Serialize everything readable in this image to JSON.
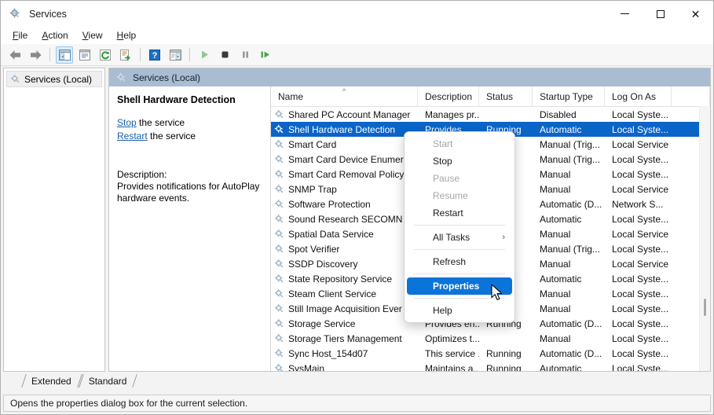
{
  "window": {
    "title": "Services",
    "icon": "services-gear-icon",
    "controls": {
      "minimize": "Minimize",
      "maximize": "Maximize",
      "close": "Close"
    }
  },
  "menubar": {
    "items": [
      {
        "label": "File",
        "accel": "F"
      },
      {
        "label": "Action",
        "accel": "A"
      },
      {
        "label": "View",
        "accel": "V"
      },
      {
        "label": "Help",
        "accel": "H"
      }
    ]
  },
  "toolbar": {
    "buttons": [
      {
        "name": "back-icon",
        "enabled": false
      },
      {
        "name": "forward-icon",
        "enabled": false
      },
      {
        "name": "separator"
      },
      {
        "name": "show-hide-console-tree-icon",
        "pressed": true
      },
      {
        "name": "properties-icon",
        "enabled": true
      },
      {
        "name": "refresh-icon",
        "enabled": true
      },
      {
        "name": "export-list-icon",
        "enabled": true
      },
      {
        "name": "separator"
      },
      {
        "name": "help-icon",
        "enabled": true
      },
      {
        "name": "show-action-pane-icon",
        "enabled": true
      },
      {
        "name": "separator"
      },
      {
        "name": "start-service-icon",
        "enabled": true
      },
      {
        "name": "stop-service-icon",
        "enabled": true
      },
      {
        "name": "pause-service-icon",
        "enabled": false
      },
      {
        "name": "restart-service-icon",
        "enabled": true
      }
    ]
  },
  "tree": {
    "items": [
      {
        "label": "Services (Local)",
        "icon": "services-gear-icon",
        "selected": true
      }
    ]
  },
  "detail": {
    "banner": "Services (Local)",
    "service_name": "Shell Hardware Detection",
    "links": [
      {
        "link": "Stop",
        "suffix": " the service"
      },
      {
        "link": "Restart",
        "suffix": " the service"
      }
    ],
    "description_label": "Description:",
    "description_text": "Provides notifications for AutoPlay hardware events."
  },
  "list": {
    "columns": [
      {
        "key": "name",
        "label": "Name",
        "sorted": "asc",
        "sort_glyph": "^"
      },
      {
        "key": "description",
        "label": "Description"
      },
      {
        "key": "status",
        "label": "Status"
      },
      {
        "key": "startup",
        "label": "Startup Type"
      },
      {
        "key": "logon",
        "label": "Log On As"
      }
    ],
    "rows": [
      {
        "name": "Shared PC Account Manager",
        "description": "Manages pr...",
        "status": "",
        "startup": "Disabled",
        "logon": "Local Syste...",
        "selected": false
      },
      {
        "name": "Shell Hardware Detection",
        "description": "Provides ...",
        "status": "Running",
        "startup": "Automatic",
        "logon": "Local Syste...",
        "selected": true
      },
      {
        "name": "Smart Card",
        "description": "",
        "status": "",
        "startup": "Manual (Trig...",
        "logon": "Local Service",
        "selected": false
      },
      {
        "name": "Smart Card Device Enumer",
        "description": "",
        "status": "",
        "startup": "Manual (Trig...",
        "logon": "Local Syste...",
        "selected": false
      },
      {
        "name": "Smart Card Removal Policy",
        "description": "",
        "status": "",
        "startup": "Manual",
        "logon": "Local Syste...",
        "selected": false
      },
      {
        "name": "SNMP Trap",
        "description": "",
        "status": "",
        "startup": "Manual",
        "logon": "Local Service",
        "selected": false
      },
      {
        "name": "Software Protection",
        "description": "",
        "status": "",
        "startup": "Automatic (D...",
        "logon": "Network S...",
        "selected": false
      },
      {
        "name": "Sound Research SECOMN S",
        "description": "",
        "status": "",
        "startup": "Automatic",
        "logon": "Local Syste...",
        "selected": false
      },
      {
        "name": "Spatial Data Service",
        "description": "",
        "status": "",
        "startup": "Manual",
        "logon": "Local Service",
        "selected": false
      },
      {
        "name": "Spot Verifier",
        "description": "",
        "status": "",
        "startup": "Manual (Trig...",
        "logon": "Local Syste...",
        "selected": false
      },
      {
        "name": "SSDP Discovery",
        "description": "",
        "status": "",
        "startup": "Manual",
        "logon": "Local Service",
        "selected": false
      },
      {
        "name": "State Repository Service",
        "description": "",
        "status": "",
        "startup": "Automatic",
        "logon": "Local Syste...",
        "selected": false
      },
      {
        "name": "Steam Client Service",
        "description": "",
        "status": "",
        "startup": "Manual",
        "logon": "Local Syste...",
        "selected": false
      },
      {
        "name": "Still Image Acquisition Ever",
        "description": "",
        "status": "",
        "startup": "Manual",
        "logon": "Local Syste...",
        "selected": false
      },
      {
        "name": "Storage Service",
        "description": "Provides en...",
        "status": "Running",
        "startup": "Automatic (D...",
        "logon": "Local Syste...",
        "selected": false
      },
      {
        "name": "Storage Tiers Management",
        "description": "Optimizes t...",
        "status": "",
        "startup": "Manual",
        "logon": "Local Syste...",
        "selected": false
      },
      {
        "name": "Sync Host_154d07",
        "description": "This service ...",
        "status": "Running",
        "startup": "Automatic (D...",
        "logon": "Local Syste...",
        "selected": false
      },
      {
        "name": "SysMain",
        "description": "Maintains a...",
        "status": "Running",
        "startup": "Automatic",
        "logon": "Local Syste...",
        "selected": false
      }
    ]
  },
  "context_menu": {
    "items": [
      {
        "label": "Start",
        "state": "disabled"
      },
      {
        "label": "Stop",
        "state": "normal"
      },
      {
        "label": "Pause",
        "state": "disabled"
      },
      {
        "label": "Resume",
        "state": "disabled"
      },
      {
        "label": "Restart",
        "state": "normal"
      },
      {
        "separator": true
      },
      {
        "label": "All Tasks",
        "state": "normal",
        "submenu": true,
        "submenu_glyph": "›"
      },
      {
        "separator": true
      },
      {
        "label": "Refresh",
        "state": "normal"
      },
      {
        "separator": true
      },
      {
        "label": "Properties",
        "state": "highlight"
      },
      {
        "separator": true
      },
      {
        "label": "Help",
        "state": "normal"
      }
    ]
  },
  "tabs": [
    {
      "label": "Extended",
      "active": false
    },
    {
      "label": "Standard",
      "active": true
    }
  ],
  "statusbar": {
    "text": "Opens the properties dialog box for the current selection."
  },
  "colors": {
    "selection_blue": "#0b64c8",
    "menu_highlight_blue": "#0b74d8",
    "banner_blue": "#a9bcd2",
    "link_blue": "#1a5fa8",
    "window_bg": "#ffffff"
  }
}
